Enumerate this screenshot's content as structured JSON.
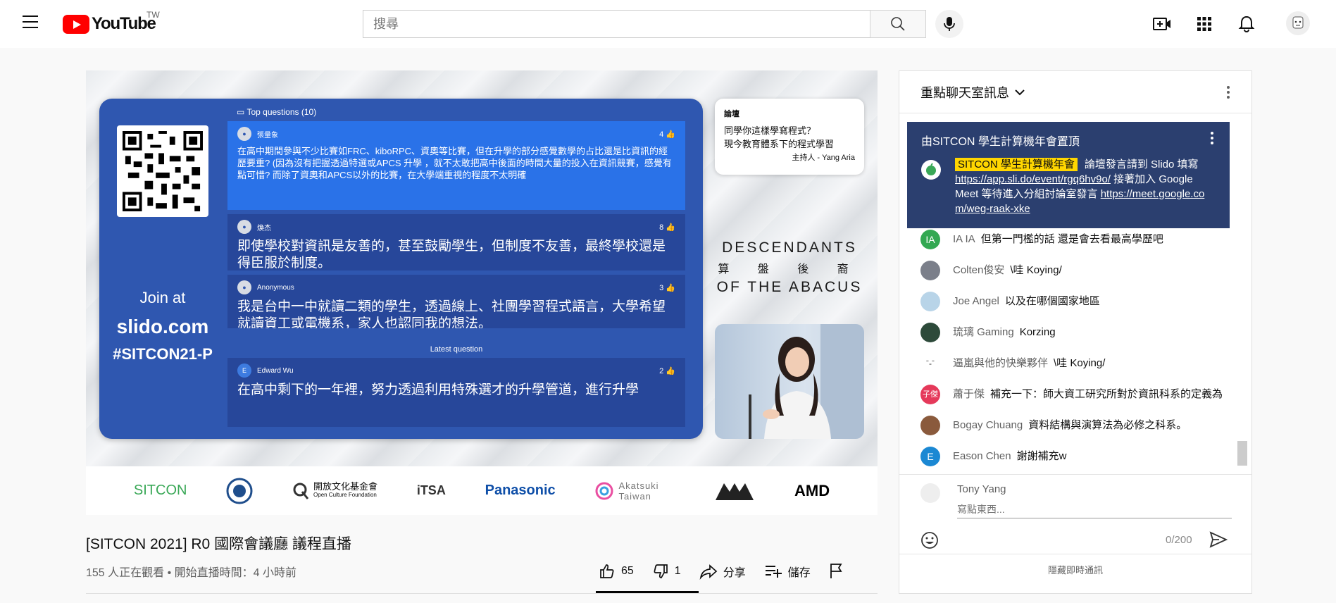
{
  "header": {
    "logo_text": "YouTube",
    "region": "TW",
    "search_placeholder": "搜尋"
  },
  "video": {
    "slido": {
      "top_questions_label": "Top questions (10)",
      "join_line1": "Join at",
      "join_line2": "slido.com",
      "join_line3": "#SITCON21-P",
      "latest_label": "Latest question",
      "questions": [
        {
          "author": "張量象",
          "likes": "4",
          "text": "在高中期間參與不少比賽如FRC、kiboRPC、資奧等比賽，但在升學的部分感覺數學的占比還是比資訊的經歷要重? (因為沒有把握透過特選或APCS 升學 ，就不太敢把高中後面的時間大量的投入在資訊競賽，感覺有點可惜? 而除了資奧和APCS以外的比賽，在大學端重視的程度不太明確"
        },
        {
          "author": "煥杰",
          "likes": "8",
          "text": "即使學校對資訊是友善的，甚至鼓勵學生，但制度不友善，最終學校還是得臣服於制度。"
        },
        {
          "author": "Anonymous",
          "likes": "3",
          "text": "我是台中一中就讀二類的學生，透過線上、社團學習程式語言，大學希望就讀資工或電機系，家人也認同我的想法。"
        },
        {
          "author": "Edward Wu",
          "avatar": "E",
          "likes": "2",
          "text": "在高中剩下的一年裡，努力透過利用特殊選才的升學管道，進行升學"
        }
      ]
    },
    "side_card": {
      "label": "論壇",
      "line1": "同學你這樣學寫程式？",
      "line2": "現今教育體系下的程式學習",
      "host": "主持人 - Yang Aria"
    },
    "doa": {
      "line1": "DESCENDANTS",
      "line2": "算 盤 後 裔",
      "line3": "OF THE ABACUS"
    },
    "sponsors": [
      "SITCON",
      "開放文化基金會",
      "iTSA",
      "Panasonic",
      "Akatsuki Taiwan",
      "AMD"
    ],
    "sponsor_sub": "Open Culture Foundation"
  },
  "title": "[SITCON 2021] R0 國際會議廳 議程直播",
  "meta": "155 人正在觀看 • 開始直播時間：4 小時前",
  "actions": {
    "likes": "65",
    "dislikes": "1",
    "share": "分享",
    "save": "儲存"
  },
  "chat": {
    "header": "重點聊天室訊息",
    "pinned": {
      "title": "由SITCON 學生計算機年會置頂",
      "badge": "SITCON 學生計算機年會",
      "text1": "論壇發言請到 Slido 填寫",
      "link1": "https://app.sli.do/event/rgq6hv9o/",
      "text2": "接著加入 Google Meet 等待進入分組討論室發言",
      "link2": "https://meet.google.com/weg-raak-xke"
    },
    "messages": [
      {
        "avatar": "IA",
        "color": "#33a852",
        "name": "IA IA",
        "text": "但第一門檻的話 還是會去看最高學歷吧"
      },
      {
        "avatar": "",
        "color": "#7b7f8a",
        "name": "Colten俊安",
        "text": "\\哇 Koying/"
      },
      {
        "avatar": "",
        "color": "#b8d4e8",
        "name": "Joe Angel",
        "text": "以及在哪個國家地區"
      },
      {
        "avatar": "",
        "color": "#2d4a3a",
        "name": "琉璃 Gaming",
        "text": "Korzing"
      },
      {
        "avatar": "ˉ-ˉ",
        "color": "#ffffff",
        "name": "逼嵐與他的快樂夥伴",
        "text": "\\哇 Koying/"
      },
      {
        "avatar": "子傑",
        "color": "#e5395a",
        "name": "蕭于傑",
        "text": "補充一下：師大資工研究所對於資訊科系的定義為"
      },
      {
        "avatar": "",
        "color": "#8a5a3c",
        "name": "Bogay Chuang",
        "text": "資料結構與演算法為必修之科系。"
      },
      {
        "avatar": "E",
        "color": "#1b88d3",
        "name": "Eason Chen",
        "text": "謝謝補充w"
      }
    ],
    "input": {
      "user": "Tony Yang",
      "placeholder": "寫點東西...",
      "count": "0/200"
    },
    "hide": "隱藏即時通訊"
  }
}
